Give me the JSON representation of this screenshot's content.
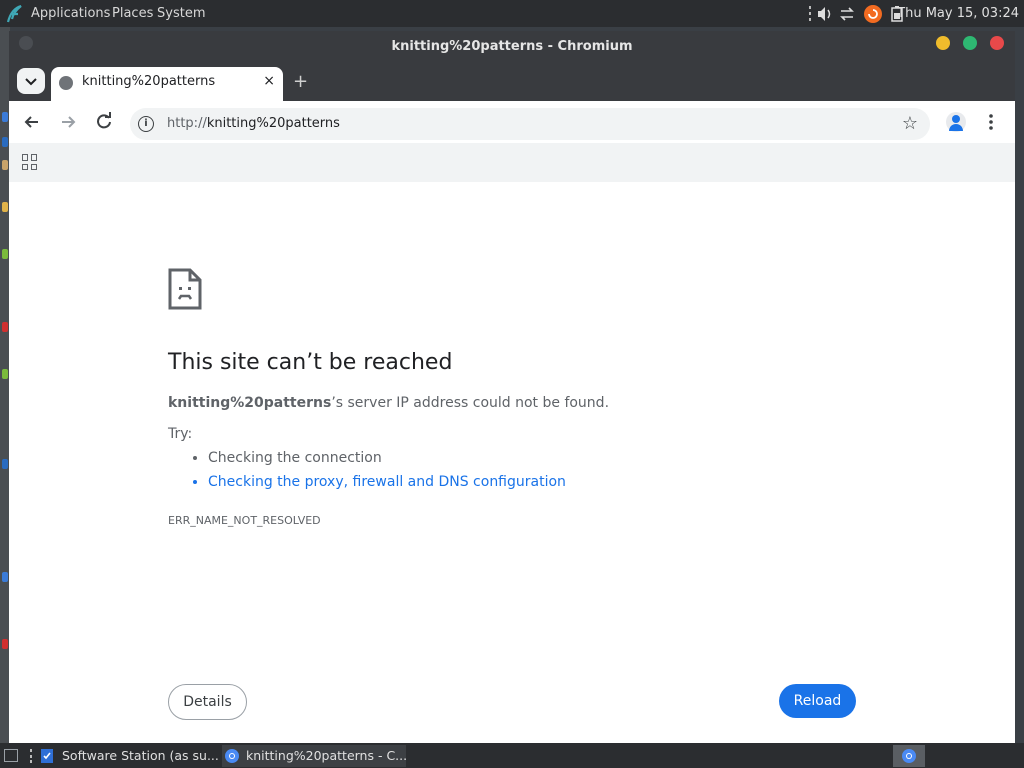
{
  "top_panel": {
    "menus": [
      "Applications",
      "Places",
      "System"
    ],
    "clock": "Thu May 15, 03:24"
  },
  "window": {
    "title": "knitting%20patterns - Chromium",
    "tab": {
      "title": "knitting%20patterns",
      "close": "×",
      "new_tab": "+"
    },
    "omnibox": {
      "scheme": "http://",
      "host": "knitting%20patterns"
    }
  },
  "error_page": {
    "heading": "This site can’t be reached",
    "host": "knitting%20patterns",
    "summary_rest": "’s server IP address could not be found.",
    "try_label": "Try:",
    "suggestions": [
      "Checking the connection",
      "Checking the proxy, firewall and DNS configuration"
    ],
    "error_code": "ERR_NAME_NOT_RESOLVED",
    "details_button": "Details",
    "reload_button": "Reload"
  },
  "taskbar": {
    "items": [
      "Software Station (as su...",
      "knitting%20patterns - C..."
    ]
  },
  "colors": {
    "accent": "#1a73e8",
    "titlebar": "#393b3f",
    "panel": "#2b2d30"
  }
}
